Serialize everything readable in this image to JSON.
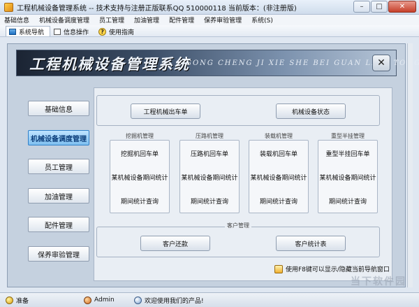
{
  "window": {
    "title": "工程机械设备管理系统 -- 技术支持与注册正版联系QQ 510000118   当前版本：(非注册版)",
    "minimize_label": "–",
    "maximize_label": "□",
    "close_label": "✕"
  },
  "menu": [
    "基础信息",
    "机械设备调度管理",
    "员工管理",
    "加油管理",
    "配件管理",
    "保养审验管理",
    "系统(S)"
  ],
  "tabs": [
    {
      "label": "系统导航",
      "icon": "nav-icon",
      "active": true
    },
    {
      "label": "信息操作",
      "icon": "info-icon",
      "active": false
    },
    {
      "label": "使用指南",
      "icon": "help-icon",
      "active": false
    }
  ],
  "banner": {
    "title": "工程机械设备管理系统",
    "pinyin": "GONG CHENG JI XIE SHE BEI GUAN LI XI TONG",
    "close_label": "✕"
  },
  "nav": [
    {
      "label": "基础信息",
      "active": false
    },
    {
      "label": "机械设备调度管理",
      "active": true
    },
    {
      "label": "员工管理",
      "active": false
    },
    {
      "label": "加油管理",
      "active": false
    },
    {
      "label": "配件管理",
      "active": false
    },
    {
      "label": "保养审验管理",
      "active": false
    }
  ],
  "top_buttons": [
    "工程机械出车单",
    "机械设备状态"
  ],
  "boxes": [
    {
      "title": "挖掘机管理",
      "links": [
        "挖掘机回车单",
        "某机械设备期间统计",
        "期间统计查询"
      ]
    },
    {
      "title": "压路机管理",
      "links": [
        "压路机回车单",
        "某机械设备期间统计",
        "期间统计查询"
      ]
    },
    {
      "title": "装载机管理",
      "links": [
        "装载机回车单",
        "某机械设备期间统计",
        "期间统计查询"
      ]
    },
    {
      "title": "重型半挂管理",
      "links": [
        "重型半挂回车单",
        "某机械设备期间统计",
        "期间统计查询"
      ]
    }
  ],
  "customer_group": {
    "title": "客户管理",
    "buttons": [
      "客户还款",
      "客户统计表"
    ]
  },
  "hint": "使用F8键可以显示/隐藏当前导航窗口",
  "status": {
    "ready": "准备",
    "user": "Admin",
    "welcome": "欢迎使用我们的产品!"
  },
  "watermark": "当下软件园"
}
